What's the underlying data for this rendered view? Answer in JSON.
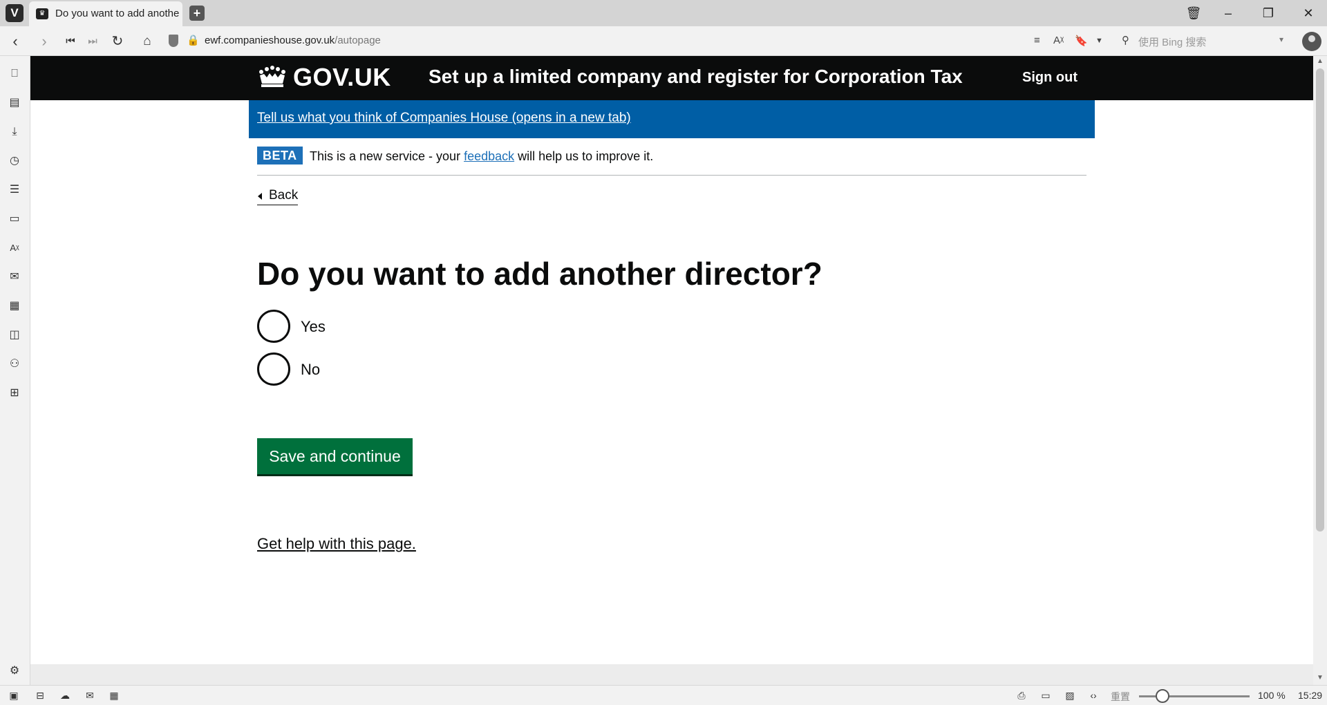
{
  "browser": {
    "tab_title": "Do you want to add another director?",
    "url_host": "ewf.companieshouse.gov.uk",
    "url_path": "/autopage",
    "search_placeholder": "使用 Bing 搜索",
    "zoom_label": "重置",
    "zoom_value": "100 %",
    "clock": "15:29"
  },
  "header": {
    "logo_text": "GOV.UK",
    "service_name": "Set up a limited company and register for Corporation Tax",
    "sign_out": "Sign out"
  },
  "feedback_banner": {
    "link_text": "Tell us what you think of Companies House (opens in a new tab)"
  },
  "phase_banner": {
    "tag": "BETA",
    "text_before": "This is a new service - your ",
    "link_text": "feedback",
    "text_after": " will help us to improve it."
  },
  "back_link": "Back",
  "question": "Do you want to add another director?",
  "options": [
    {
      "label": "Yes",
      "selected": false
    },
    {
      "label": "No",
      "selected": false
    }
  ],
  "save_button": "Save and continue",
  "help_link": "Get help with this page.",
  "colors": {
    "header_bg": "#0b0c0c",
    "banner_blue": "#005ea5",
    "button_green": "#00703c",
    "link_blue": "#1d70b8"
  }
}
